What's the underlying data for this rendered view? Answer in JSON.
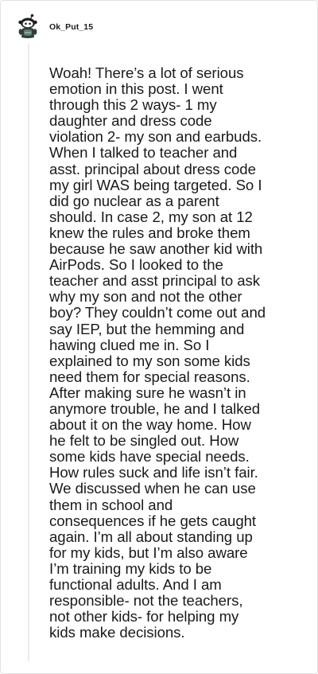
{
  "comment": {
    "author": "Ok_Put_15",
    "avatar_icon": "reddit-snoo-avatar-icon",
    "body_lines": [
      "Woah! There’s a lot of serious",
      "emotion in this post. I went",
      "through this 2 ways- 1 my",
      "daughter and dress code",
      "violation 2- my son and earbuds.",
      "When I talked to teacher and",
      "asst. principal about dress code",
      "my girl WAS being targeted. So I",
      "did go nuclear as a parent",
      "should. In case 2, my son at 12",
      "knew the rules and broke them",
      "because he saw another kid with",
      "AirPods. So I looked to the",
      "teacher and asst principal to ask",
      "why my son and not the other",
      "boy? They couldn’t come out and",
      "say IEP, but the hemming and",
      "hawing clued me in. So I",
      "explained to my son some kids",
      "need them for special reasons.",
      "After making sure he wasn’t in",
      "anymore trouble, he and I talked",
      "about it on the way home. How",
      "he felt to be singled out. How",
      "some kids have special needs.",
      "How rules suck and life isn’t fair.",
      "We discussed when he can use",
      "them in school and",
      "consequences if he gets caught",
      "again. I’m all about standing up",
      "for my kids, but I’m also aware",
      "I’m training my kids to be",
      "functional adults. And I am",
      "responsible- not the teachers,",
      "not other kids- for helping my",
      "kids make decisions."
    ]
  }
}
